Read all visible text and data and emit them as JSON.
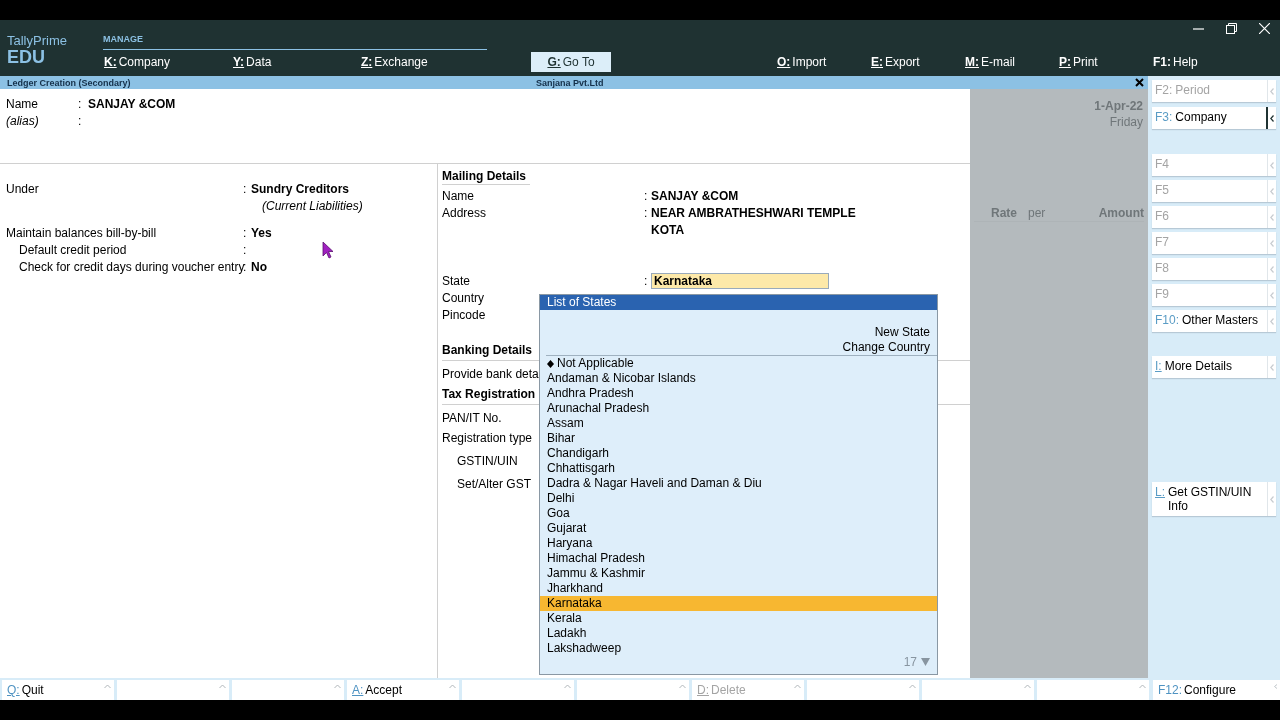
{
  "header": {
    "app_name": "TallyPrime",
    "edition": "EDU",
    "section": "MANAGE",
    "menu": [
      {
        "key": "K:",
        "label": "Company",
        "highlighted": false
      },
      {
        "key": "Y:",
        "label": "Data",
        "highlighted": false
      },
      {
        "key": "Z:",
        "label": "Exchange",
        "highlighted": false
      },
      {
        "key": "G:",
        "label": "Go To",
        "highlighted": true
      },
      {
        "key": "O:",
        "label": "Import",
        "highlighted": false
      },
      {
        "key": "E:",
        "label": "Export",
        "highlighted": false
      },
      {
        "key": "M:",
        "label": "E-mail",
        "highlighted": false
      },
      {
        "key": "P:",
        "label": "Print",
        "highlighted": false
      },
      {
        "key": "F1:",
        "label": "Help",
        "highlighted": false
      }
    ]
  },
  "title_bar": {
    "title": "Ledger Creation (Secondary)",
    "company": "Sanjana Pvt.Ltd"
  },
  "ledger": {
    "fields": [
      {
        "label": "Name",
        "sep": ":",
        "value": "SANJAY &COM",
        "italic": false
      },
      {
        "label": "(alias)",
        "sep": ":",
        "italic": true
      }
    ]
  },
  "left_fields": [
    {
      "label": "Under",
      "sep": ":",
      "value": "Sundry Creditors",
      "note": "(Current Liabilities)",
      "indented": false
    },
    {
      "label": "Maintain balances bill-by-bill",
      "sep": ":",
      "value": "Yes",
      "indented": false
    },
    {
      "label": "Default credit period",
      "sep": ":",
      "indented": true
    },
    {
      "label": "Check for credit days during voucher entry",
      "sep": ":",
      "value": "No",
      "indented": true
    }
  ],
  "mailing": {
    "heading": "Mailing Details",
    "fields": [
      {
        "label": "Name",
        "sep": ":",
        "values": [
          "SANJAY &COM"
        ],
        "kind": "text"
      },
      {
        "label": "Address",
        "sep": ":",
        "values": [
          "NEAR AMBRATHESHWARI TEMPLE",
          "KOTA"
        ],
        "kind": "text"
      },
      {
        "label": "State",
        "sep": ":",
        "values": [
          "Karnataka"
        ],
        "kind": "input"
      },
      {
        "label": "Country",
        "kind": "text"
      },
      {
        "label": "Pincode",
        "kind": "text"
      }
    ]
  },
  "banking": {
    "heading": "Banking Details",
    "fields": [
      {
        "label": "Provide bank deta",
        "indented": false
      }
    ]
  },
  "tax": {
    "heading": "Tax Registration",
    "fields": [
      {
        "label": "PAN/IT No.",
        "indented": false
      },
      {
        "label": "Registration type",
        "indented": false
      },
      {
        "label": "GSTIN/UIN",
        "indented": true
      },
      {
        "label": "Set/Alter GST",
        "indented": true
      }
    ]
  },
  "info_panel": {
    "date": "1-Apr-22",
    "day": "Friday",
    "columns": [
      "Rate",
      "per",
      "Amount"
    ]
  },
  "state_list": {
    "title": "List of States",
    "actions": [
      "New State",
      "Change Country"
    ],
    "count": "17",
    "items": [
      {
        "label": "Not Applicable",
        "default": true,
        "selected": false
      },
      {
        "label": "Andaman & Nicobar Islands",
        "default": false,
        "selected": false
      },
      {
        "label": "Andhra Pradesh",
        "default": false,
        "selected": false
      },
      {
        "label": "Arunachal Pradesh",
        "default": false,
        "selected": false
      },
      {
        "label": "Assam",
        "default": false,
        "selected": false
      },
      {
        "label": "Bihar",
        "default": false,
        "selected": false
      },
      {
        "label": "Chandigarh",
        "default": false,
        "selected": false
      },
      {
        "label": "Chhattisgarh",
        "default": false,
        "selected": false
      },
      {
        "label": "Dadra & Nagar Haveli and Daman & Diu",
        "default": false,
        "selected": false
      },
      {
        "label": "Delhi",
        "default": false,
        "selected": false
      },
      {
        "label": "Goa",
        "default": false,
        "selected": false
      },
      {
        "label": "Gujarat",
        "default": false,
        "selected": false
      },
      {
        "label": "Haryana",
        "default": false,
        "selected": false
      },
      {
        "label": "Himachal Pradesh",
        "default": false,
        "selected": false
      },
      {
        "label": "Jammu & Kashmir",
        "default": false,
        "selected": false
      },
      {
        "label": "Jharkhand",
        "default": false,
        "selected": false
      },
      {
        "label": "Karnataka",
        "default": false,
        "selected": true
      },
      {
        "label": "Kerala",
        "default": false,
        "selected": false
      },
      {
        "label": "Ladakh",
        "default": false,
        "selected": false
      },
      {
        "label": "Lakshadweep",
        "default": false,
        "selected": false
      }
    ]
  },
  "side_panel": {
    "groups": [
      {
        "buttons": [
          {
            "key": "F2:",
            "label": "Period",
            "disabled": true,
            "selected": false,
            "underlined": false
          },
          {
            "key": "F3:",
            "label": "Company",
            "disabled": false,
            "selected": true,
            "underlined": false
          }
        ]
      },
      {
        "buttons": [
          {
            "key": "F4",
            "disabled": true,
            "selected": false,
            "underlined": false
          },
          {
            "key": "F5",
            "disabled": true,
            "selected": false,
            "underlined": false
          },
          {
            "key": "F6",
            "disabled": true,
            "selected": false,
            "underlined": false
          },
          {
            "key": "F7",
            "disabled": true,
            "selected": false,
            "underlined": false
          },
          {
            "key": "F8",
            "disabled": true,
            "selected": false,
            "underlined": false
          },
          {
            "key": "F9",
            "disabled": true,
            "selected": false,
            "underlined": false
          },
          {
            "key": "F10:",
            "label": "Other Masters",
            "disabled": false,
            "selected": false,
            "underlined": false
          }
        ]
      },
      {
        "buttons": [
          {
            "key": "I:",
            "label": "More Details",
            "disabled": false,
            "selected": false,
            "underlined": true
          }
        ]
      },
      {
        "buttons": [
          {
            "key": "L:",
            "label": "Get GSTIN/UIN Info",
            "disabled": false,
            "selected": false,
            "underlined": true
          }
        ]
      }
    ]
  },
  "bottom_bar": [
    {
      "kind": "button",
      "key": "Q:",
      "label": "Quit",
      "disabled": false
    },
    {
      "kind": "blank"
    },
    {
      "kind": "blank"
    },
    {
      "kind": "button",
      "key": "A:",
      "label": "Accept",
      "disabled": false
    },
    {
      "kind": "blank"
    },
    {
      "kind": "blank"
    },
    {
      "kind": "button",
      "key": "D:",
      "label": "Delete",
      "disabled": true
    },
    {
      "kind": "blank"
    },
    {
      "kind": "blank"
    },
    {
      "kind": "blank"
    },
    {
      "kind": "button",
      "key": "F12:",
      "label": "Configure",
      "disabled": false
    }
  ]
}
